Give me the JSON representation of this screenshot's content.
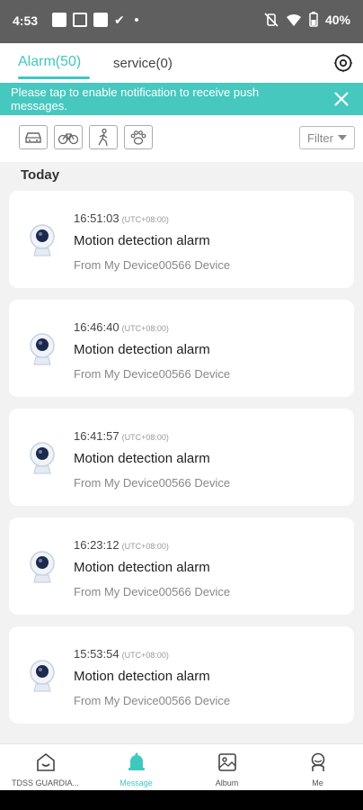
{
  "status_bar": {
    "time": "4:53",
    "battery_text": "40%",
    "icons": [
      "image-icon",
      "newspaper-icon",
      "app-icon",
      "check-icon",
      "dot-icon",
      "vibrate-off-icon",
      "wifi-icon",
      "battery-icon"
    ]
  },
  "tabs": {
    "alarm_label": "Alarm(50)",
    "service_label": "service(0)"
  },
  "notification": {
    "text": "Please tap to enable notification to receive push messages."
  },
  "filter": {
    "categories": [
      "car-icon",
      "bicycle-icon",
      "person-walking-icon",
      "pet-paw-icon"
    ],
    "label": "Filter"
  },
  "section_title": "Today",
  "alarms": [
    {
      "time": "16:51:03",
      "tz": "(UTC+08:00)",
      "title": "Motion detection alarm",
      "source": "From My Device00566 Device"
    },
    {
      "time": "16:46:40",
      "tz": "(UTC+08:00)",
      "title": "Motion detection alarm",
      "source": "From My Device00566 Device"
    },
    {
      "time": "16:41:57",
      "tz": "(UTC+08:00)",
      "title": "Motion detection alarm",
      "source": "From My Device00566 Device"
    },
    {
      "time": "16:23:12",
      "tz": "(UTC+08:00)",
      "title": "Motion detection alarm",
      "source": "From My Device00566 Device"
    },
    {
      "time": "15:53:54",
      "tz": "(UTC+08:00)",
      "title": "Motion detection alarm",
      "source": "From My Device00566 Device"
    }
  ],
  "bottom_nav": [
    {
      "label": "TDSS GUARDIA...",
      "icon": "home-icon",
      "active": false
    },
    {
      "label": "Message",
      "icon": "bell-icon",
      "active": true
    },
    {
      "label": "Album",
      "icon": "picture-icon",
      "active": false
    },
    {
      "label": "Me",
      "icon": "person-icon",
      "active": false
    }
  ],
  "colors": {
    "accent": "#3ec8c0",
    "banner": "#46c8bf",
    "status_bar": "#5f5f5f"
  }
}
